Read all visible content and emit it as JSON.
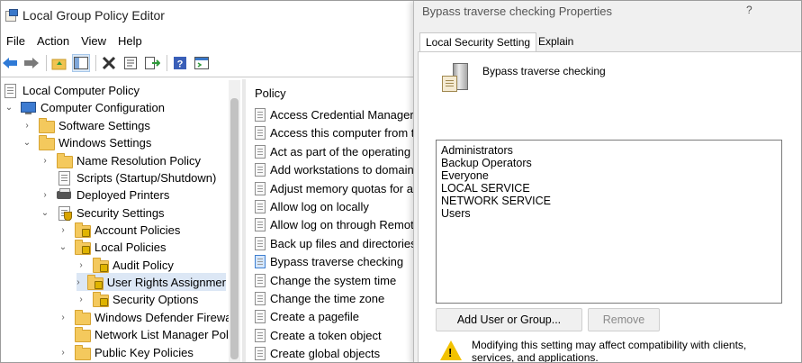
{
  "main_window": {
    "title": "Local Group Policy Editor",
    "menu": [
      "File",
      "Action",
      "View",
      "Help"
    ],
    "toolbar_icons": [
      "back-arrow-icon",
      "forward-arrow-icon",
      "up-folder-icon",
      "show-hide-tree-icon",
      "delete-icon",
      "properties-icon",
      "export-list-icon",
      "help-icon",
      "console-icon"
    ]
  },
  "tree": {
    "items": [
      {
        "label": "Local Computer Policy",
        "chevron": ""
      },
      {
        "label": "Computer Configuration",
        "chevron": "⌄"
      },
      {
        "label": "Software Settings",
        "chevron": "›"
      },
      {
        "label": "Windows Settings",
        "chevron": "⌄"
      },
      {
        "label": "Name Resolution Policy",
        "chevron": "›"
      },
      {
        "label": "Scripts (Startup/Shutdown)",
        "chevron": ""
      },
      {
        "label": "Deployed Printers",
        "chevron": "›"
      },
      {
        "label": "Security Settings",
        "chevron": "⌄"
      },
      {
        "label": "Account Policies",
        "chevron": "›"
      },
      {
        "label": "Local Policies",
        "chevron": "⌄"
      },
      {
        "label": "Audit Policy",
        "chevron": "›"
      },
      {
        "label": "User Rights Assignmer",
        "chevron": "›"
      },
      {
        "label": "Security Options",
        "chevron": "›"
      },
      {
        "label": "Windows Defender Firewal",
        "chevron": "›"
      },
      {
        "label": "Network List Manager Poli",
        "chevron": ""
      },
      {
        "label": "Public Key Policies",
        "chevron": "›"
      }
    ]
  },
  "list": {
    "header": "Policy",
    "items": [
      "Access Credential Manager as",
      "Access this computer from the",
      "Act as part of the operating sy",
      "Add workstations to domain",
      "Adjust memory quotas for a p",
      "Allow log on locally",
      "Allow log on through Remote",
      "Back up files and directories",
      "Bypass traverse checking",
      "Change the system time",
      "Change the time zone",
      "Create a pagefile",
      "Create a token object",
      "Create global objects"
    ],
    "selected_index": 8
  },
  "dialog": {
    "title": "Bypass traverse checking Properties",
    "help": "?",
    "tabs": [
      "Local Security Setting",
      "Explain"
    ],
    "active_tab": 0,
    "policy_name": "Bypass traverse checking",
    "members": [
      "Administrators",
      "Backup Operators",
      "Everyone",
      "LOCAL SERVICE",
      "NETWORK SERVICE",
      "Users"
    ],
    "add_button": "Add User or Group...",
    "remove_button": "Remove",
    "warning": "Modifying this setting may affect compatibility with clients, services, and applications."
  }
}
